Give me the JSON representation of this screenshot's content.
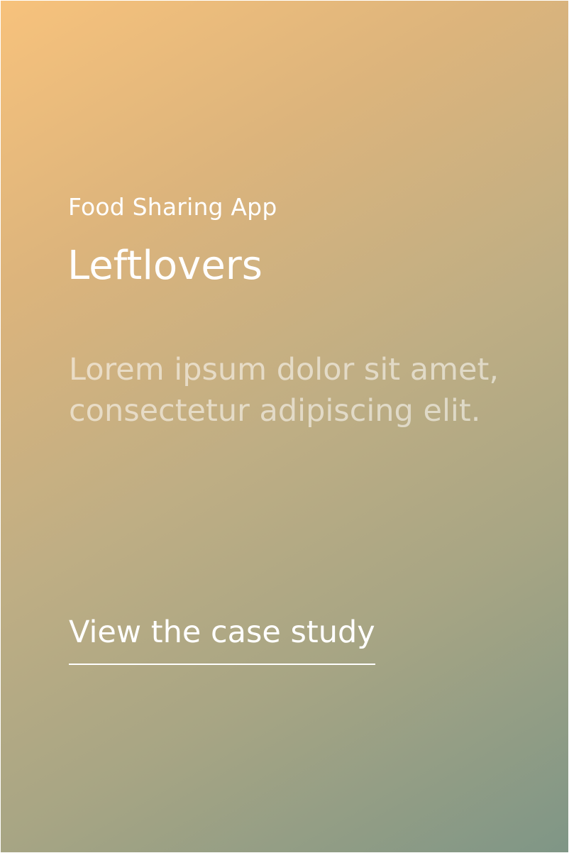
{
  "card": {
    "subtitle": "Food Sharing App",
    "title": "Leftlovers",
    "description": "Lorem ipsum dolor sit amet, consectetur adipiscing elit.",
    "cta_label": "View the case study"
  },
  "colors": {
    "gradient_start": "#f7c27c",
    "gradient_end": "#7f9686",
    "text": "#ffffff"
  }
}
